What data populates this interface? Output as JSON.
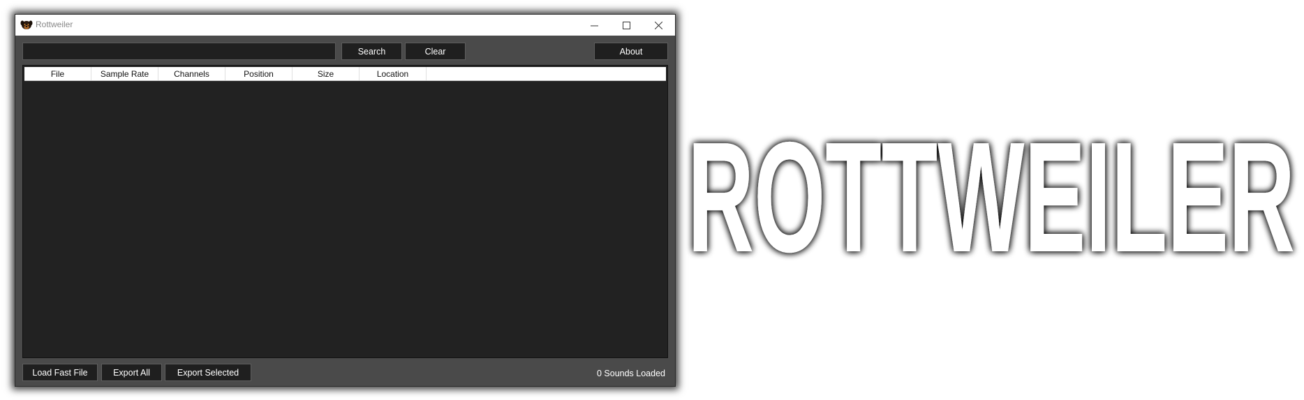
{
  "window": {
    "title": "Rottweiler",
    "controls": {
      "minimize": "minimize-icon",
      "maximize": "maximize-icon",
      "close": "close-icon"
    }
  },
  "toolbar": {
    "search_value": "",
    "search_label": "Search",
    "clear_label": "Clear",
    "about_label": "About"
  },
  "table": {
    "columns": [
      "File",
      "Sample Rate",
      "Channels",
      "Position",
      "Size",
      "Location"
    ],
    "rows": []
  },
  "footer": {
    "load_label": "Load Fast File",
    "export_all_label": "Export All",
    "export_selected_label": "Export Selected",
    "status": "0 Sounds Loaded"
  },
  "branding": {
    "logo_text": "ROTTWEILER"
  },
  "colors": {
    "window_bg": "#4a4a4a",
    "control_bg": "#1f1f1f",
    "grid_bg": "#222222",
    "text": "#ffffff"
  }
}
